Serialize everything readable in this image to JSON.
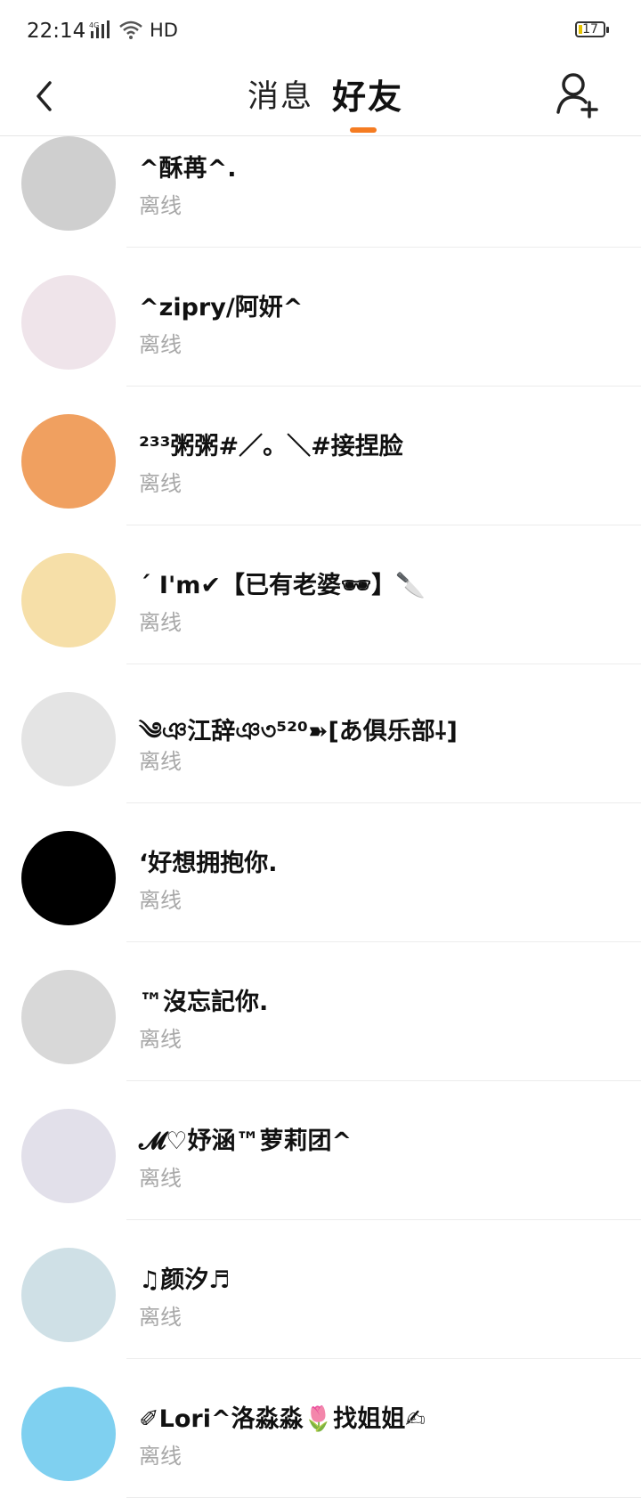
{
  "status_bar": {
    "time": "22:14",
    "network": "4G",
    "hd": "HD",
    "battery": "17"
  },
  "header": {
    "tab_messages": "消息",
    "tab_friends": "好友",
    "accent_color": "#f57c22"
  },
  "friends": [
    {
      "name": "^酥苒^.",
      "status": "离线",
      "avatar_color": "#cfcfcf"
    },
    {
      "name": "^zipry/阿妍^",
      "status": "离线",
      "avatar_color": "#efe4ea"
    },
    {
      "name": "²³³粥粥󠀠#／。＼#接捏脸",
      "status": "离线",
      "avatar_color": "#f0a060"
    },
    {
      "name": "´ I'm✔【已有老婆🕶】🔪",
      "status": "离线",
      "avatar_color": "#f6dfa8"
    },
    {
      "name": "༄ঞ江辞ঞ৩⁵²⁰➽[あ俱乐部⸸]",
      "status": "离线",
      "avatar_color": "#e4e4e4"
    },
    {
      "name": "‘好想拥抱你.",
      "status": "离线",
      "avatar_color": "#000000"
    },
    {
      "name": "™沒忘記你.",
      "status": "离线",
      "avatar_color": "#d8d8d8"
    },
    {
      "name": "𝓜♡妤涵™萝莉团^",
      "status": "离线",
      "avatar_color": "#e2e0ea"
    },
    {
      "name": "♫颜汐♬",
      "status": "离线",
      "avatar_color": "#cfe0e6"
    },
    {
      "name": "✐Lori^洛淼淼🌷找姐姐✍",
      "status": "离线",
      "avatar_color": "#7fd0f0"
    }
  ]
}
